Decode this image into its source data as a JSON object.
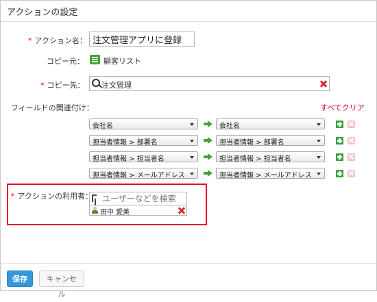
{
  "dialog": {
    "title": "アクションの設定"
  },
  "required_mark": "*",
  "action_name": {
    "label": "アクション名：",
    "value": "注文管理アプリに登録"
  },
  "copy_from": {
    "label": "コピー元：",
    "app_name": "顧客リスト",
    "icon": "app-icon"
  },
  "copy_to": {
    "label": "コピー先：",
    "value": "注文管理"
  },
  "field_mapping": {
    "label": "フィールドの関連付け：",
    "clear_all": "すべてクリア",
    "rows": [
      {
        "source": "会社名",
        "target": "会社名"
      },
      {
        "source": "担当者情報 > 部署名",
        "target": "担当者情報 > 部署名"
      },
      {
        "source": "担当者情報 > 担当者名",
        "target": "担当者情報 > 担当者名"
      },
      {
        "source": "担当者情報 > メールアドレス",
        "target": "担当者情報 > メールアドレス"
      }
    ]
  },
  "action_users": {
    "label": "アクションの利用者：",
    "search_placeholder": "ユーザーなどを検索",
    "users": [
      {
        "name": "田中 愛美"
      }
    ]
  },
  "footer": {
    "save_label": "保存",
    "cancel_label": "キャンセル"
  },
  "colors": {
    "accent": "#3498db",
    "required": "#e60012",
    "highlight": "#e4002b",
    "add": "#34a33b",
    "clear": "#e5003c"
  }
}
